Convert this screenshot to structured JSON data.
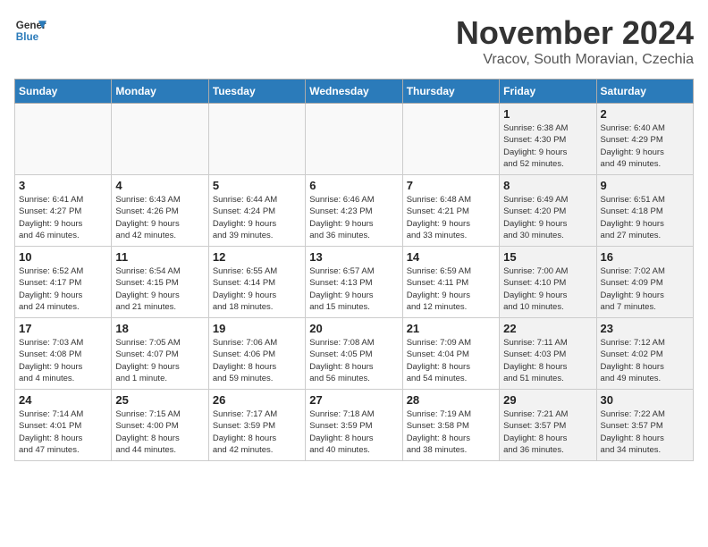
{
  "header": {
    "logo_line1": "General",
    "logo_line2": "Blue",
    "month": "November 2024",
    "location": "Vracov, South Moravian, Czechia"
  },
  "days_of_week": [
    "Sunday",
    "Monday",
    "Tuesday",
    "Wednesday",
    "Thursday",
    "Friday",
    "Saturday"
  ],
  "weeks": [
    [
      {
        "day": "",
        "info": "",
        "empty": true
      },
      {
        "day": "",
        "info": "",
        "empty": true
      },
      {
        "day": "",
        "info": "",
        "empty": true
      },
      {
        "day": "",
        "info": "",
        "empty": true
      },
      {
        "day": "",
        "info": "",
        "empty": true
      },
      {
        "day": "1",
        "info": "Sunrise: 6:38 AM\nSunset: 4:30 PM\nDaylight: 9 hours\nand 52 minutes.",
        "shaded": true
      },
      {
        "day": "2",
        "info": "Sunrise: 6:40 AM\nSunset: 4:29 PM\nDaylight: 9 hours\nand 49 minutes.",
        "shaded": true
      }
    ],
    [
      {
        "day": "3",
        "info": "Sunrise: 6:41 AM\nSunset: 4:27 PM\nDaylight: 9 hours\nand 46 minutes."
      },
      {
        "day": "4",
        "info": "Sunrise: 6:43 AM\nSunset: 4:26 PM\nDaylight: 9 hours\nand 42 minutes."
      },
      {
        "day": "5",
        "info": "Sunrise: 6:44 AM\nSunset: 4:24 PM\nDaylight: 9 hours\nand 39 minutes."
      },
      {
        "day": "6",
        "info": "Sunrise: 6:46 AM\nSunset: 4:23 PM\nDaylight: 9 hours\nand 36 minutes."
      },
      {
        "day": "7",
        "info": "Sunrise: 6:48 AM\nSunset: 4:21 PM\nDaylight: 9 hours\nand 33 minutes."
      },
      {
        "day": "8",
        "info": "Sunrise: 6:49 AM\nSunset: 4:20 PM\nDaylight: 9 hours\nand 30 minutes.",
        "shaded": true
      },
      {
        "day": "9",
        "info": "Sunrise: 6:51 AM\nSunset: 4:18 PM\nDaylight: 9 hours\nand 27 minutes.",
        "shaded": true
      }
    ],
    [
      {
        "day": "10",
        "info": "Sunrise: 6:52 AM\nSunset: 4:17 PM\nDaylight: 9 hours\nand 24 minutes."
      },
      {
        "day": "11",
        "info": "Sunrise: 6:54 AM\nSunset: 4:15 PM\nDaylight: 9 hours\nand 21 minutes."
      },
      {
        "day": "12",
        "info": "Sunrise: 6:55 AM\nSunset: 4:14 PM\nDaylight: 9 hours\nand 18 minutes."
      },
      {
        "day": "13",
        "info": "Sunrise: 6:57 AM\nSunset: 4:13 PM\nDaylight: 9 hours\nand 15 minutes."
      },
      {
        "day": "14",
        "info": "Sunrise: 6:59 AM\nSunset: 4:11 PM\nDaylight: 9 hours\nand 12 minutes."
      },
      {
        "day": "15",
        "info": "Sunrise: 7:00 AM\nSunset: 4:10 PM\nDaylight: 9 hours\nand 10 minutes.",
        "shaded": true
      },
      {
        "day": "16",
        "info": "Sunrise: 7:02 AM\nSunset: 4:09 PM\nDaylight: 9 hours\nand 7 minutes.",
        "shaded": true
      }
    ],
    [
      {
        "day": "17",
        "info": "Sunrise: 7:03 AM\nSunset: 4:08 PM\nDaylight: 9 hours\nand 4 minutes."
      },
      {
        "day": "18",
        "info": "Sunrise: 7:05 AM\nSunset: 4:07 PM\nDaylight: 9 hours\nand 1 minute."
      },
      {
        "day": "19",
        "info": "Sunrise: 7:06 AM\nSunset: 4:06 PM\nDaylight: 8 hours\nand 59 minutes."
      },
      {
        "day": "20",
        "info": "Sunrise: 7:08 AM\nSunset: 4:05 PM\nDaylight: 8 hours\nand 56 minutes."
      },
      {
        "day": "21",
        "info": "Sunrise: 7:09 AM\nSunset: 4:04 PM\nDaylight: 8 hours\nand 54 minutes."
      },
      {
        "day": "22",
        "info": "Sunrise: 7:11 AM\nSunset: 4:03 PM\nDaylight: 8 hours\nand 51 minutes.",
        "shaded": true
      },
      {
        "day": "23",
        "info": "Sunrise: 7:12 AM\nSunset: 4:02 PM\nDaylight: 8 hours\nand 49 minutes.",
        "shaded": true
      }
    ],
    [
      {
        "day": "24",
        "info": "Sunrise: 7:14 AM\nSunset: 4:01 PM\nDaylight: 8 hours\nand 47 minutes."
      },
      {
        "day": "25",
        "info": "Sunrise: 7:15 AM\nSunset: 4:00 PM\nDaylight: 8 hours\nand 44 minutes."
      },
      {
        "day": "26",
        "info": "Sunrise: 7:17 AM\nSunset: 3:59 PM\nDaylight: 8 hours\nand 42 minutes."
      },
      {
        "day": "27",
        "info": "Sunrise: 7:18 AM\nSunset: 3:59 PM\nDaylight: 8 hours\nand 40 minutes."
      },
      {
        "day": "28",
        "info": "Sunrise: 7:19 AM\nSunset: 3:58 PM\nDaylight: 8 hours\nand 38 minutes."
      },
      {
        "day": "29",
        "info": "Sunrise: 7:21 AM\nSunset: 3:57 PM\nDaylight: 8 hours\nand 36 minutes.",
        "shaded": true
      },
      {
        "day": "30",
        "info": "Sunrise: 7:22 AM\nSunset: 3:57 PM\nDaylight: 8 hours\nand 34 minutes.",
        "shaded": true
      }
    ]
  ]
}
